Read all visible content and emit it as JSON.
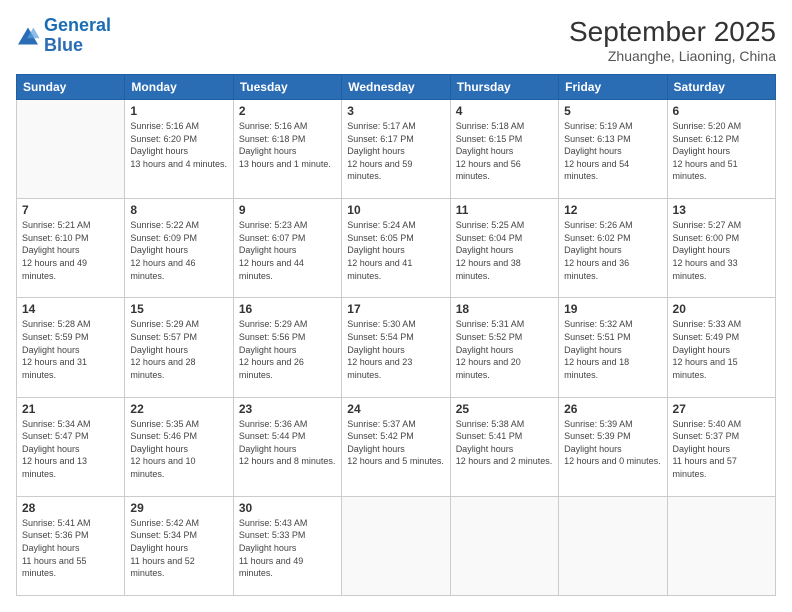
{
  "logo": {
    "line1": "General",
    "line2": "Blue"
  },
  "title": "September 2025",
  "subtitle": "Zhuanghe, Liaoning, China",
  "weekdays": [
    "Sunday",
    "Monday",
    "Tuesday",
    "Wednesday",
    "Thursday",
    "Friday",
    "Saturday"
  ],
  "weeks": [
    [
      {
        "day": "",
        "empty": true
      },
      {
        "day": "1",
        "sunrise": "5:16 AM",
        "sunset": "6:20 PM",
        "daylight": "13 hours and 4 minutes."
      },
      {
        "day": "2",
        "sunrise": "5:16 AM",
        "sunset": "6:18 PM",
        "daylight": "13 hours and 1 minute."
      },
      {
        "day": "3",
        "sunrise": "5:17 AM",
        "sunset": "6:17 PM",
        "daylight": "12 hours and 59 minutes."
      },
      {
        "day": "4",
        "sunrise": "5:18 AM",
        "sunset": "6:15 PM",
        "daylight": "12 hours and 56 minutes."
      },
      {
        "day": "5",
        "sunrise": "5:19 AM",
        "sunset": "6:13 PM",
        "daylight": "12 hours and 54 minutes."
      },
      {
        "day": "6",
        "sunrise": "5:20 AM",
        "sunset": "6:12 PM",
        "daylight": "12 hours and 51 minutes."
      }
    ],
    [
      {
        "day": "7",
        "sunrise": "5:21 AM",
        "sunset": "6:10 PM",
        "daylight": "12 hours and 49 minutes."
      },
      {
        "day": "8",
        "sunrise": "5:22 AM",
        "sunset": "6:09 PM",
        "daylight": "12 hours and 46 minutes."
      },
      {
        "day": "9",
        "sunrise": "5:23 AM",
        "sunset": "6:07 PM",
        "daylight": "12 hours and 44 minutes."
      },
      {
        "day": "10",
        "sunrise": "5:24 AM",
        "sunset": "6:05 PM",
        "daylight": "12 hours and 41 minutes."
      },
      {
        "day": "11",
        "sunrise": "5:25 AM",
        "sunset": "6:04 PM",
        "daylight": "12 hours and 38 minutes."
      },
      {
        "day": "12",
        "sunrise": "5:26 AM",
        "sunset": "6:02 PM",
        "daylight": "12 hours and 36 minutes."
      },
      {
        "day": "13",
        "sunrise": "5:27 AM",
        "sunset": "6:00 PM",
        "daylight": "12 hours and 33 minutes."
      }
    ],
    [
      {
        "day": "14",
        "sunrise": "5:28 AM",
        "sunset": "5:59 PM",
        "daylight": "12 hours and 31 minutes."
      },
      {
        "day": "15",
        "sunrise": "5:29 AM",
        "sunset": "5:57 PM",
        "daylight": "12 hours and 28 minutes."
      },
      {
        "day": "16",
        "sunrise": "5:29 AM",
        "sunset": "5:56 PM",
        "daylight": "12 hours and 26 minutes."
      },
      {
        "day": "17",
        "sunrise": "5:30 AM",
        "sunset": "5:54 PM",
        "daylight": "12 hours and 23 minutes."
      },
      {
        "day": "18",
        "sunrise": "5:31 AM",
        "sunset": "5:52 PM",
        "daylight": "12 hours and 20 minutes."
      },
      {
        "day": "19",
        "sunrise": "5:32 AM",
        "sunset": "5:51 PM",
        "daylight": "12 hours and 18 minutes."
      },
      {
        "day": "20",
        "sunrise": "5:33 AM",
        "sunset": "5:49 PM",
        "daylight": "12 hours and 15 minutes."
      }
    ],
    [
      {
        "day": "21",
        "sunrise": "5:34 AM",
        "sunset": "5:47 PM",
        "daylight": "12 hours and 13 minutes."
      },
      {
        "day": "22",
        "sunrise": "5:35 AM",
        "sunset": "5:46 PM",
        "daylight": "12 hours and 10 minutes."
      },
      {
        "day": "23",
        "sunrise": "5:36 AM",
        "sunset": "5:44 PM",
        "daylight": "12 hours and 8 minutes."
      },
      {
        "day": "24",
        "sunrise": "5:37 AM",
        "sunset": "5:42 PM",
        "daylight": "12 hours and 5 minutes."
      },
      {
        "day": "25",
        "sunrise": "5:38 AM",
        "sunset": "5:41 PM",
        "daylight": "12 hours and 2 minutes."
      },
      {
        "day": "26",
        "sunrise": "5:39 AM",
        "sunset": "5:39 PM",
        "daylight": "12 hours and 0 minutes."
      },
      {
        "day": "27",
        "sunrise": "5:40 AM",
        "sunset": "5:37 PM",
        "daylight": "11 hours and 57 minutes."
      }
    ],
    [
      {
        "day": "28",
        "sunrise": "5:41 AM",
        "sunset": "5:36 PM",
        "daylight": "11 hours and 55 minutes."
      },
      {
        "day": "29",
        "sunrise": "5:42 AM",
        "sunset": "5:34 PM",
        "daylight": "11 hours and 52 minutes."
      },
      {
        "day": "30",
        "sunrise": "5:43 AM",
        "sunset": "5:33 PM",
        "daylight": "11 hours and 49 minutes."
      },
      {
        "day": "",
        "empty": true
      },
      {
        "day": "",
        "empty": true
      },
      {
        "day": "",
        "empty": true
      },
      {
        "day": "",
        "empty": true
      }
    ]
  ]
}
